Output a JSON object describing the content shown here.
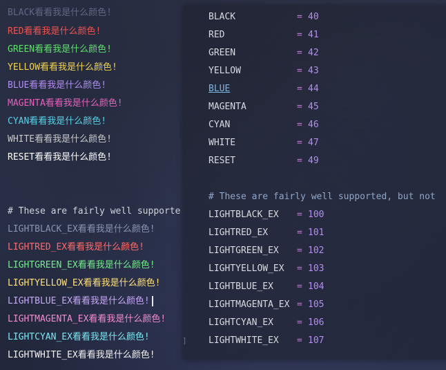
{
  "terminal": {
    "top_clipped": "BLACK看看我是什么颜色!",
    "lines": [
      {
        "text": "RED看看我是什么颜色!",
        "color": "#ef5350"
      },
      {
        "text": "GREEN看看我是什么颜色!",
        "color": "#5ee06a"
      },
      {
        "text": "YELLOW看看我是什么颜色!",
        "color": "#f2d24b"
      },
      {
        "text": "BLUE看看我是什么颜色!",
        "color": "#b08cf0"
      },
      {
        "text": "MAGENTA看看我是什么颜色!",
        "color": "#e85fbd"
      },
      {
        "text": "CYAN看看我是什么颜色!",
        "color": "#57d2e6"
      },
      {
        "text": "WHITE看看我是什么颜色!",
        "color": "#c9c9c9"
      },
      {
        "text": "RESET看看我是什么颜色!",
        "color": "#ffffff"
      }
    ],
    "comment": "# These are fairly well supporte",
    "light_lines": [
      {
        "text": "LIGHTBLACK_EX看看我是什么颜色!",
        "color": "#8a93b0"
      },
      {
        "text": "LIGHTRED_EX看看我是什么颜色!",
        "color": "#ff6b6b"
      },
      {
        "text": "LIGHTGREEN_EX看看我是什么颜色!",
        "color": "#74ec8c"
      },
      {
        "text": "LIGHTYELLOW_EX看看我是什么颜色!",
        "color": "#ffe07a"
      },
      {
        "text": "LIGHTBLUE_EX看看我是什么颜色!",
        "color": "#c7a8f5"
      },
      {
        "text": "LIGHTMAGENTA_EX看看我是什么颜色!",
        "color": "#f28bd0"
      },
      {
        "text": "LIGHTCYAN_EX看看我是什么颜色!",
        "color": "#7ee6f2"
      },
      {
        "text": "LIGHTWHITE_EX看看我是什么颜色!",
        "color": "#f2f2f2"
      }
    ]
  },
  "popup": {
    "entries": [
      {
        "name": "BLACK",
        "eq": "=",
        "value": "40"
      },
      {
        "name": "RED",
        "eq": "=",
        "value": "41"
      },
      {
        "name": "GREEN",
        "eq": "=",
        "value": "42"
      },
      {
        "name": "YELLOW",
        "eq": "=",
        "value": "43"
      },
      {
        "name": "BLUE",
        "eq": "=",
        "value": "44"
      },
      {
        "name": "MAGENTA",
        "eq": "=",
        "value": "45"
      },
      {
        "name": "CYAN",
        "eq": "=",
        "value": "46"
      },
      {
        "name": "WHITE",
        "eq": "=",
        "value": "47"
      },
      {
        "name": "RESET",
        "eq": "=",
        "value": "49"
      }
    ],
    "comment": "# These are fairly well supported, but not",
    "light_entries": [
      {
        "name": "LIGHTBLACK_EX",
        "eq": "=",
        "value": "100"
      },
      {
        "name": "LIGHTRED_EX",
        "eq": "=",
        "value": "101"
      },
      {
        "name": "LIGHTGREEN_EX",
        "eq": "=",
        "value": "102"
      },
      {
        "name": "LIGHTYELLOW_EX",
        "eq": "=",
        "value": "103"
      },
      {
        "name": "LIGHTBLUE_EX",
        "eq": "=",
        "value": "104"
      },
      {
        "name": "LIGHTMAGENTA_EX",
        "eq": "=",
        "value": "105"
      },
      {
        "name": "LIGHTCYAN_EX",
        "eq": "=",
        "value": "106"
      },
      {
        "name": "LIGHTWHITE_EX",
        "eq": "=",
        "value": "107"
      }
    ]
  },
  "gutter": {
    "mark": "]"
  }
}
